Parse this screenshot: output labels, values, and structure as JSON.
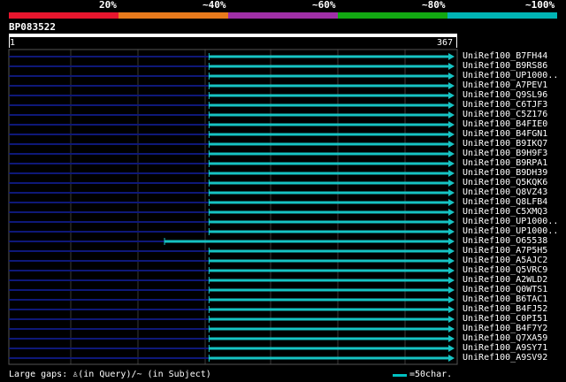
{
  "scale": {
    "labels": [
      "20%",
      "~40%",
      "~60%",
      "~80%",
      "~100%"
    ],
    "colors": [
      "#e8162e",
      "#e87a1c",
      "#a02fa7",
      "#12a812",
      "#00b4b4"
    ]
  },
  "query": {
    "name": "BP083522",
    "start": "1",
    "end": "367"
  },
  "colors": {
    "hit": "#16c3c3",
    "unaligned": "#0e1878",
    "grid": "#3a3a3a"
  },
  "hits": [
    {
      "name": "UniRef100_B7FH44",
      "start": 0.45,
      "end": 1.0
    },
    {
      "name": "UniRef100_B9RS86",
      "start": 0.45,
      "end": 1.0
    },
    {
      "name": "UniRef100_UP1000..",
      "start": 0.45,
      "end": 1.0
    },
    {
      "name": "UniRef100_A7PEV1",
      "start": 0.45,
      "end": 1.0
    },
    {
      "name": "UniRef100_Q9SL96",
      "start": 0.45,
      "end": 1.0
    },
    {
      "name": "UniRef100_C6TJF3",
      "start": 0.45,
      "end": 1.0
    },
    {
      "name": "UniRef100_C5Z176",
      "start": 0.45,
      "end": 1.0
    },
    {
      "name": "UniRef100_B4FIE0",
      "start": 0.45,
      "end": 1.0
    },
    {
      "name": "UniRef100_B4FGN1",
      "start": 0.45,
      "end": 1.0
    },
    {
      "name": "UniRef100_B9IKQ7",
      "start": 0.45,
      "end": 1.0
    },
    {
      "name": "UniRef100_B9H9F3",
      "start": 0.45,
      "end": 1.0
    },
    {
      "name": "UniRef100_B9RPA1",
      "start": 0.45,
      "end": 1.0
    },
    {
      "name": "UniRef100_B9DH39",
      "start": 0.45,
      "end": 1.0
    },
    {
      "name": "UniRef100_Q5KQK6",
      "start": 0.45,
      "end": 1.0
    },
    {
      "name": "UniRef100_Q8VZ43",
      "start": 0.45,
      "end": 1.0
    },
    {
      "name": "UniRef100_Q8LFB4",
      "start": 0.45,
      "end": 1.0
    },
    {
      "name": "UniRef100_C5XMQ3",
      "start": 0.45,
      "end": 1.0
    },
    {
      "name": "UniRef100_UP1000..",
      "start": 0.45,
      "end": 1.0
    },
    {
      "name": "UniRef100_UP1000..",
      "start": 0.45,
      "end": 1.0
    },
    {
      "name": "UniRef100_O65538",
      "start": 0.35,
      "end": 1.0
    },
    {
      "name": "UniRef100_A7P5H5",
      "start": 0.45,
      "end": 1.0
    },
    {
      "name": "UniRef100_A5AJC2",
      "start": 0.45,
      "end": 1.0
    },
    {
      "name": "UniRef100_Q5VRC9",
      "start": 0.45,
      "end": 1.0
    },
    {
      "name": "UniRef100_A2WLD2",
      "start": 0.45,
      "end": 1.0
    },
    {
      "name": "UniRef100_Q0WTS1",
      "start": 0.45,
      "end": 1.0
    },
    {
      "name": "UniRef100_B6TAC1",
      "start": 0.45,
      "end": 1.0
    },
    {
      "name": "UniRef100_B4FJ52",
      "start": 0.45,
      "end": 1.0
    },
    {
      "name": "UniRef100_C0PI51",
      "start": 0.45,
      "end": 1.0
    },
    {
      "name": "UniRef100_B4F7Y2",
      "start": 0.45,
      "end": 1.0
    },
    {
      "name": "UniRef100_Q7XA59",
      "start": 0.45,
      "end": 1.0
    },
    {
      "name": "UniRef100_A9SY71",
      "start": 0.45,
      "end": 1.0
    },
    {
      "name": "UniRef100_A9SV92",
      "start": 0.45,
      "end": 1.0
    }
  ],
  "footer": {
    "text": "Large gaps: ♙(in Query)/~ (in Subject)",
    "legend": "=50char."
  }
}
